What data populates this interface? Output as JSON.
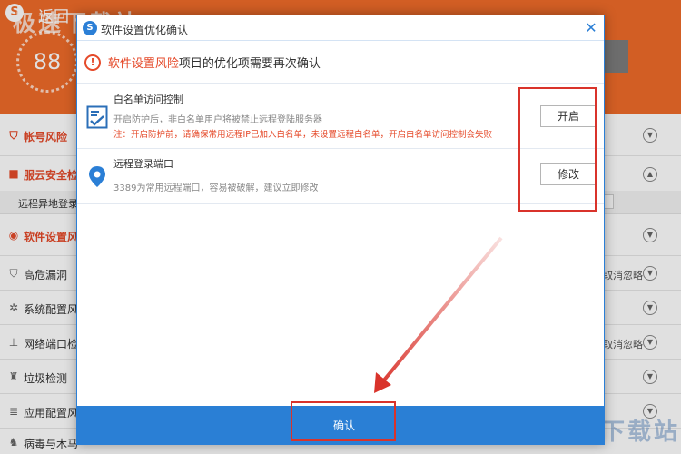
{
  "app": {
    "back_label": "返回",
    "score": "88",
    "watermark": "极速下载站",
    "watermark_bottom": "极速下载站"
  },
  "background_list": {
    "rows": [
      {
        "label": "帐号风险",
        "icon": "shield-icon"
      },
      {
        "label": "服云安全检",
        "icon": "cloud-lock-icon"
      },
      {
        "label": "软件设置风",
        "icon": "settings-icon"
      },
      {
        "label": "高危漏洞",
        "icon": "shield-icon",
        "extra": "取消忽略"
      },
      {
        "label": "系统配置风",
        "icon": "gear-icon"
      },
      {
        "label": "网络端口检",
        "icon": "network-icon",
        "extra": "取消忽略"
      },
      {
        "label": "垃圾检测",
        "icon": "broom-icon"
      },
      {
        "label": "应用配置风",
        "icon": "database-icon"
      },
      {
        "label": "病毒与木马",
        "icon": "horse-icon"
      }
    ],
    "subrow_label": "远程异地登录提"
  },
  "dialog": {
    "title": "软件设置优化确认",
    "notice_highlight": "软件设置风险",
    "notice_rest": "项目的优化项需要再次确认",
    "items": [
      {
        "title": "白名单访问控制",
        "description": "开启防护后，非白名单用户将被禁止远程登陆服务器",
        "warning": "注：开启防护前，请确保常用远程IP已加入白名单，未设置远程白名单，开启白名单访问控制会失败",
        "button": "开启",
        "icon": "checklist-icon"
      },
      {
        "title": "远程登录端口",
        "description": "3389为常用远程端口，容易被破解，建议立即修改",
        "button": "修改",
        "icon": "location-pin-icon"
      }
    ],
    "confirm_label": "确认"
  },
  "colors": {
    "header_orange": "#f06b2a",
    "dialog_blue": "#2a7fd5",
    "warning_red": "#e54a2a",
    "annotation_red": "#d9332b"
  }
}
